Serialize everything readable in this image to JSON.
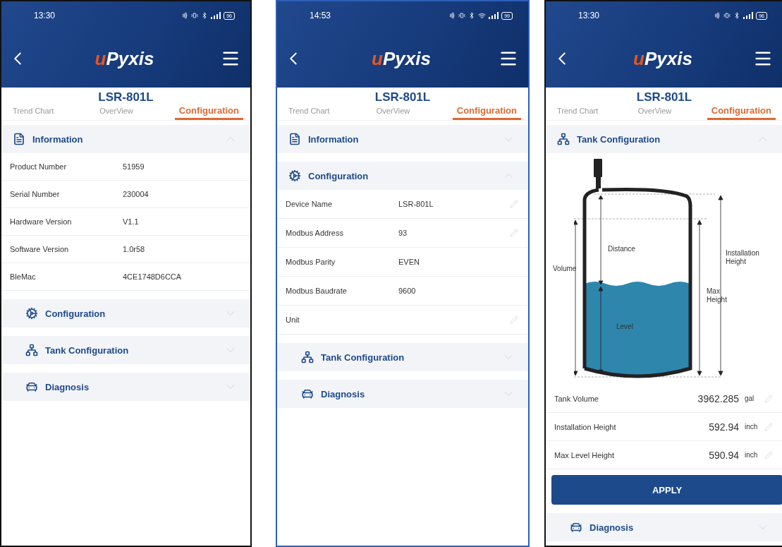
{
  "phones": [
    {
      "status_bar": {
        "time": "13:30",
        "wifi": false,
        "battery": "96"
      },
      "logo": {
        "mark": "u",
        "name": "Pyxis"
      },
      "device_title": "LSR-801L",
      "tabs": [
        {
          "label": "Trend Chart",
          "selected": false
        },
        {
          "label": "OverView",
          "selected": false
        },
        {
          "label": "Configuration",
          "selected": true
        }
      ],
      "sections": [
        {
          "kind": "information",
          "title": "Information",
          "expanded": true,
          "rows": [
            {
              "label": "Product Number",
              "value": "51959",
              "editable": false
            },
            {
              "label": "Serial Number",
              "value": "230004",
              "editable": false
            },
            {
              "label": "Hardware Version",
              "value": "V1.1",
              "editable": false
            },
            {
              "label": "Software Version",
              "value": "1.0r58",
              "editable": false
            },
            {
              "label": "BleMac",
              "value": "4CE1748D6CCA",
              "editable": false
            }
          ]
        },
        {
          "kind": "configuration",
          "title": "Configuration",
          "expanded": false
        },
        {
          "kind": "tank",
          "title": "Tank Configuration",
          "expanded": false
        },
        {
          "kind": "diagnosis",
          "title": "Diagnosis",
          "expanded": false
        }
      ]
    },
    {
      "status_bar": {
        "time": "14:53",
        "wifi": true,
        "battery": "99"
      },
      "logo": {
        "mark": "u",
        "name": "Pyxis"
      },
      "device_title": "LSR-801L",
      "tabs": [
        {
          "label": "Trend Chart",
          "selected": false
        },
        {
          "label": "OverView",
          "selected": false
        },
        {
          "label": "Configuration",
          "selected": true
        }
      ],
      "sections": [
        {
          "kind": "information",
          "title": "Information",
          "expanded": false
        },
        {
          "kind": "configuration",
          "title": "Configuration",
          "expanded": true,
          "rows": [
            {
              "label": "Device Name",
              "value": "LSR-801L",
              "editable": true
            },
            {
              "label": "Modbus Address",
              "value": "93",
              "editable": true
            },
            {
              "label": "Modbus Parity",
              "value": "EVEN",
              "editable": false
            },
            {
              "label": "Modbus Baudrate",
              "value": "9600",
              "editable": false
            },
            {
              "label": "Unit",
              "editable": true
            }
          ]
        },
        {
          "kind": "tank",
          "title": "Tank Configuration",
          "expanded": false
        },
        {
          "kind": "diagnosis",
          "title": "Diagnosis",
          "expanded": false
        }
      ]
    },
    {
      "status_bar": {
        "time": "13:30",
        "wifi": false,
        "battery": "96"
      },
      "logo": {
        "mark": "u",
        "name": "Pyxis"
      },
      "device_title": "LSR-801L",
      "tabs": [
        {
          "label": "Trend Chart",
          "selected": false
        },
        {
          "label": "OverView",
          "selected": false
        },
        {
          "label": "Configuration",
          "selected": true
        }
      ],
      "sections": [
        {
          "kind": "tank",
          "title": "Tank Configuration",
          "expanded": true,
          "diagram_labels": [
            "Distance",
            "Volume",
            "Installation Height",
            "Max Height",
            "Level"
          ],
          "rows": [
            {
              "label": "Tank Volume",
              "value": "3962.285",
              "unit": "gal",
              "editable": true
            },
            {
              "label": "Installation Height",
              "value": "592.94",
              "unit": "inch",
              "editable": true
            },
            {
              "label": "Max Level Height",
              "value": "590.94",
              "unit": "inch",
              "editable": true
            }
          ],
          "button": "APPLY"
        },
        {
          "kind": "diagnosis",
          "title": "Diagnosis",
          "expanded": false
        }
      ]
    }
  ]
}
